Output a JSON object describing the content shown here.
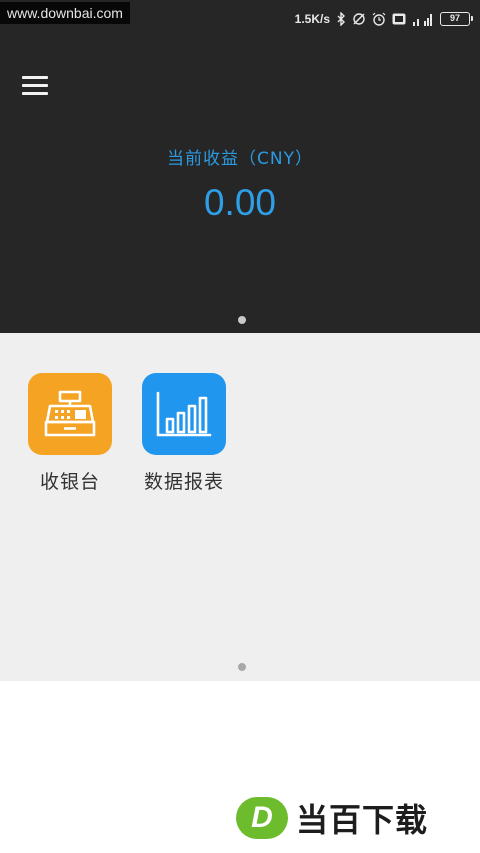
{
  "watermark": "www.downbai.com",
  "status_bar": {
    "net_speed": "1.5K/s",
    "battery_level": "97"
  },
  "earnings": {
    "label": "当前收益（CNY）",
    "value": "0.00",
    "accent_color": "#2e9fe6"
  },
  "apps": [
    {
      "label": "收银台",
      "icon": "cash-register-icon",
      "color": "#f4a323"
    },
    {
      "label": "数据报表",
      "icon": "bar-chart-icon",
      "color": "#2196ee"
    }
  ],
  "brand": {
    "mark": "D",
    "text": "当百下载",
    "color": "#6cbc2e"
  }
}
